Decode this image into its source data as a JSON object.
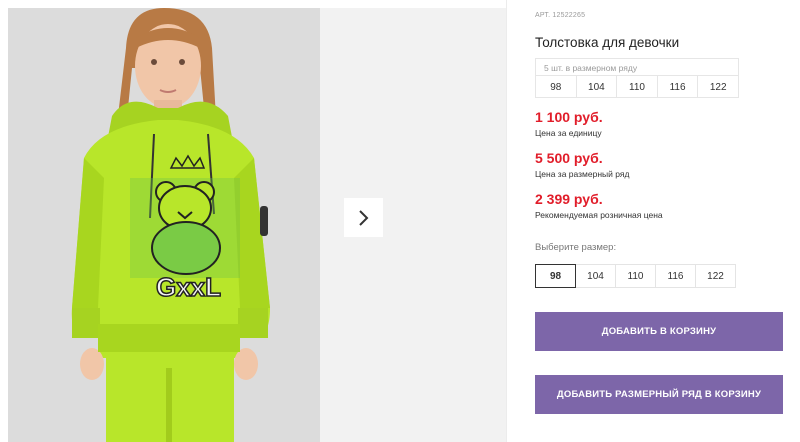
{
  "gallery": {
    "next_icon": "chevron-right-icon",
    "image_description_colors": {
      "background": "#dcdcdc",
      "hoodie": "#b8e62a",
      "print": "#3c9a3c"
    }
  },
  "product": {
    "sku": "АРТ. 12522265",
    "title": "Толстовка для девочки",
    "set_caption": "5 шт. в размерном ряду",
    "set_sizes": [
      "98",
      "104",
      "110",
      "116",
      "122"
    ],
    "prices": [
      {
        "value": "1 100 руб.",
        "note": "Цена за единицу"
      },
      {
        "value": "5 500 руб.",
        "note": "Цена за размерный ряд"
      },
      {
        "value": "2 399 руб.",
        "note": "Рекомендуемая розничная цена"
      }
    ],
    "size_label": "Выберите размер:",
    "sizes": [
      "98",
      "104",
      "110",
      "116",
      "122"
    ],
    "selected_size": "98"
  },
  "actions": {
    "add_to_cart": "ДОБАВИТЬ В КОРЗИНУ",
    "add_set_to_cart": "ДОБАВИТЬ РАЗМЕРНЫЙ РЯД В КОРЗИНУ"
  },
  "colors": {
    "price": "#e11d2a",
    "button": "#7d66a9"
  }
}
